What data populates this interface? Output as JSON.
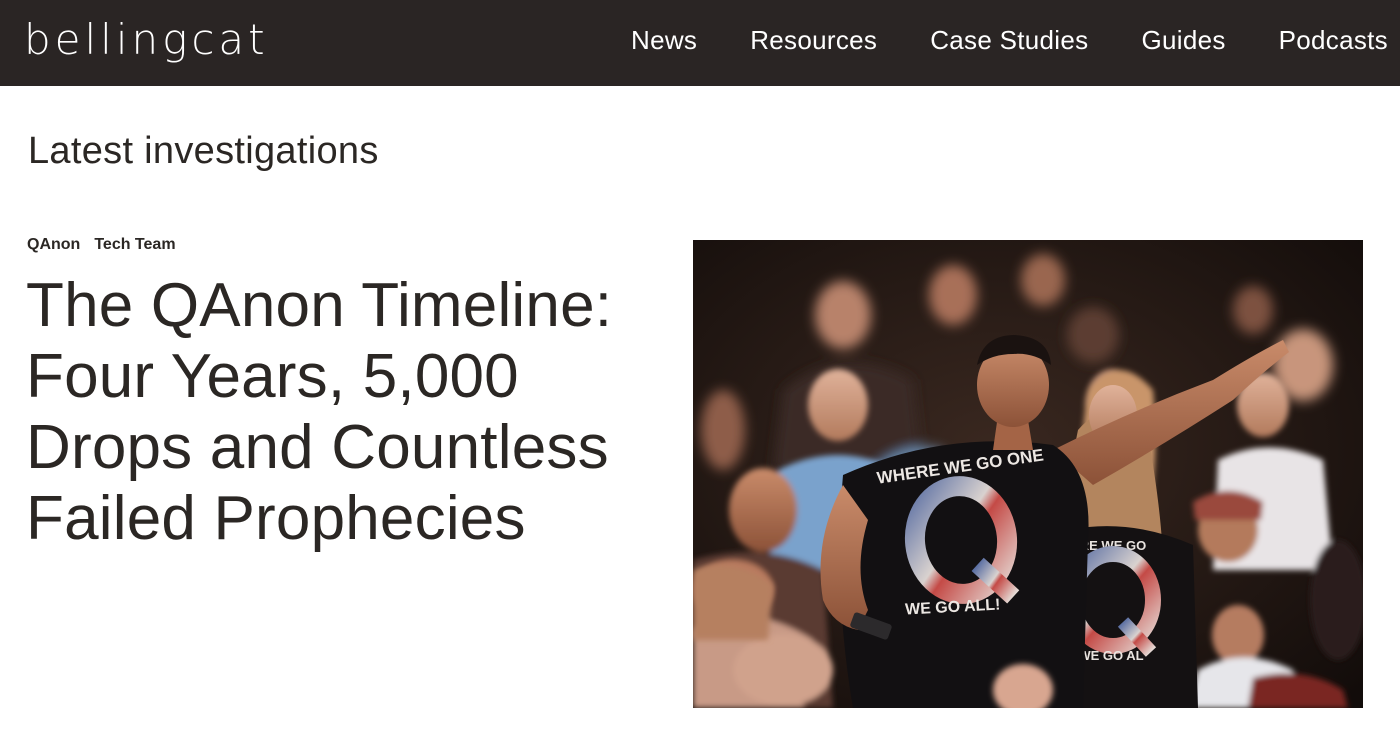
{
  "header": {
    "logo_text": "bellingcat",
    "nav": [
      {
        "label": "News"
      },
      {
        "label": "Resources"
      },
      {
        "label": "Case Studies"
      },
      {
        "label": "Guides"
      },
      {
        "label": "Podcasts"
      }
    ]
  },
  "main": {
    "section_title": "Latest investigations",
    "article": {
      "tags": [
        "QAnon",
        "Tech Team"
      ],
      "title": "The QAnon Timeline: Four Years, 5,000 Drops and Countless Failed Prophecies",
      "image": {
        "shirt_front_top": "WHERE WE GO ONE",
        "shirt_front_bottom": "WE GO ALL!",
        "shirt_back_top": "RE WE GO",
        "shirt_back_bottom": "WE GO AL"
      }
    }
  },
  "colors": {
    "header_bg": "#2a2524",
    "header_text": "#ffffff",
    "body_text": "#2b2724",
    "page_bg": "#ffffff"
  }
}
